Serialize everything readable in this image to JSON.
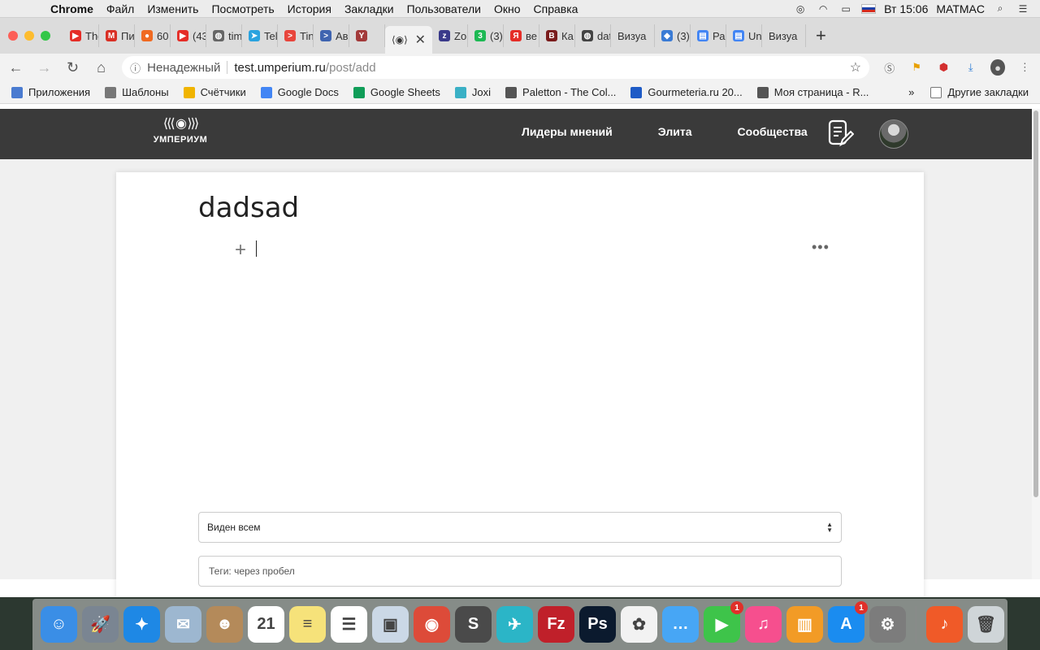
{
  "menubar": {
    "items": [
      "Chrome",
      "Файл",
      "Изменить",
      "Посмотреть",
      "История",
      "Закладки",
      "Пользователи",
      "Окно",
      "Справка"
    ],
    "clock": "Вт 15:06",
    "user": "MATMAC"
  },
  "tabs": [
    {
      "label": "The",
      "color": "#e52d27",
      "glyph": "▶"
    },
    {
      "label": "Пи",
      "color": "#d93025",
      "glyph": "M"
    },
    {
      "label": "60",
      "color": "#f06a21",
      "glyph": "●"
    },
    {
      "label": "(43",
      "color": "#e52d27",
      "glyph": "▶"
    },
    {
      "label": "tim",
      "color": "#666666",
      "glyph": "◍"
    },
    {
      "label": "Tel",
      "color": "#2aa3df",
      "glyph": "➤"
    },
    {
      "label": "Tin",
      "color": "#e8453c",
      "glyph": ">"
    },
    {
      "label": "Ав",
      "color": "#3f64b0",
      "glyph": ">"
    },
    {
      "label": "",
      "color": "#a33a3a",
      "glyph": "Y"
    },
    {
      "label": "Zo",
      "color": "#3a3a8a",
      "glyph": "z"
    },
    {
      "label": "(3)",
      "color": "#1db954",
      "glyph": "3"
    },
    {
      "label": "ве",
      "color": "#e52d27",
      "glyph": "Я"
    },
    {
      "label": "Ка",
      "color": "#7a1c1c",
      "glyph": "B"
    },
    {
      "label": "dat",
      "color": "#444444",
      "glyph": "◍"
    },
    {
      "label": "Визуа",
      "color": "#ffffff",
      "glyph": ""
    },
    {
      "label": "(3)",
      "color": "#3a7bd5",
      "glyph": "◆"
    },
    {
      "label": "Ра",
      "color": "#4285f4",
      "glyph": "▤"
    },
    {
      "label": "Un",
      "color": "#4285f4",
      "glyph": "▤"
    },
    {
      "label": "Визуа",
      "color": "#ffffff",
      "glyph": ""
    }
  ],
  "address": {
    "security": "Ненадежный",
    "host": "test.umperium.ru",
    "path": "/post/add"
  },
  "bookmarks": [
    {
      "label": "Приложения",
      "color": "#4a7bd0"
    },
    {
      "label": "Шаблоны",
      "color": "#777777"
    },
    {
      "label": "Счётчики",
      "color": "#f0b400"
    },
    {
      "label": "Google Docs",
      "color": "#4285f4"
    },
    {
      "label": "Google Sheets",
      "color": "#0f9d58"
    },
    {
      "label": "Joxi",
      "color": "#3ab0c5"
    },
    {
      "label": "Paletton - The Col...",
      "color": "#555555"
    },
    {
      "label": "Gourmeteria.ru 20...",
      "color": "#1e5bc6"
    },
    {
      "label": "Моя страница - R...",
      "color": "#555555"
    }
  ],
  "bookmarks_more": "Другие закладки",
  "site": {
    "logo_text": "УМПЕРИУМ",
    "nav": [
      "Лидеры мнений",
      "Элита",
      "Сообщества"
    ]
  },
  "editor": {
    "title": "dadsad",
    "add_glyph": "+",
    "more_glyph": "•••",
    "visibility": "Виден всем",
    "tags_placeholder": "Теги: через пробел"
  },
  "dock": [
    {
      "name": "finder",
      "color": "#3a8ee6",
      "glyph": "☺"
    },
    {
      "name": "launchpad",
      "color": "#7a8592",
      "glyph": "🚀"
    },
    {
      "name": "safari",
      "color": "#1e88e5",
      "glyph": "✦"
    },
    {
      "name": "mail",
      "color": "#9db7d0",
      "glyph": "✉"
    },
    {
      "name": "contacts",
      "color": "#b48a5a",
      "glyph": "☻"
    },
    {
      "name": "calendar",
      "color": "#ffffff",
      "glyph": "21"
    },
    {
      "name": "notes",
      "color": "#f6e27a",
      "glyph": "≡"
    },
    {
      "name": "reminders",
      "color": "#ffffff",
      "glyph": "☰"
    },
    {
      "name": "preview",
      "color": "#cbd8e6",
      "glyph": "▣"
    },
    {
      "name": "chrome",
      "color": "#dd4b39",
      "glyph": "◉"
    },
    {
      "name": "sublime",
      "color": "#4a4a4a",
      "glyph": "S"
    },
    {
      "name": "hummingbird",
      "color": "#2bb5c7",
      "glyph": "✈"
    },
    {
      "name": "filezilla",
      "color": "#c0202a",
      "glyph": "Fz"
    },
    {
      "name": "photoshop",
      "color": "#0b1a2e",
      "glyph": "Ps"
    },
    {
      "name": "photos",
      "color": "#f2f2f2",
      "glyph": "✿"
    },
    {
      "name": "messages",
      "color": "#47a6f5",
      "glyph": "…"
    },
    {
      "name": "facetime",
      "color": "#3ec44a",
      "glyph": "▶",
      "badge": "1"
    },
    {
      "name": "itunes",
      "color": "#f64f8e",
      "glyph": "♫"
    },
    {
      "name": "ibooks",
      "color": "#f29b26",
      "glyph": "▥"
    },
    {
      "name": "app-store",
      "color": "#1a8cf0",
      "glyph": "A",
      "badge": "1"
    },
    {
      "name": "system-preferences",
      "color": "#7c7c7c",
      "glyph": "⚙"
    },
    {
      "name": "garageband",
      "color": "#f05a28",
      "glyph": "♪"
    },
    {
      "name": "trash",
      "color": "#cfd5d8",
      "glyph": "🗑"
    }
  ]
}
